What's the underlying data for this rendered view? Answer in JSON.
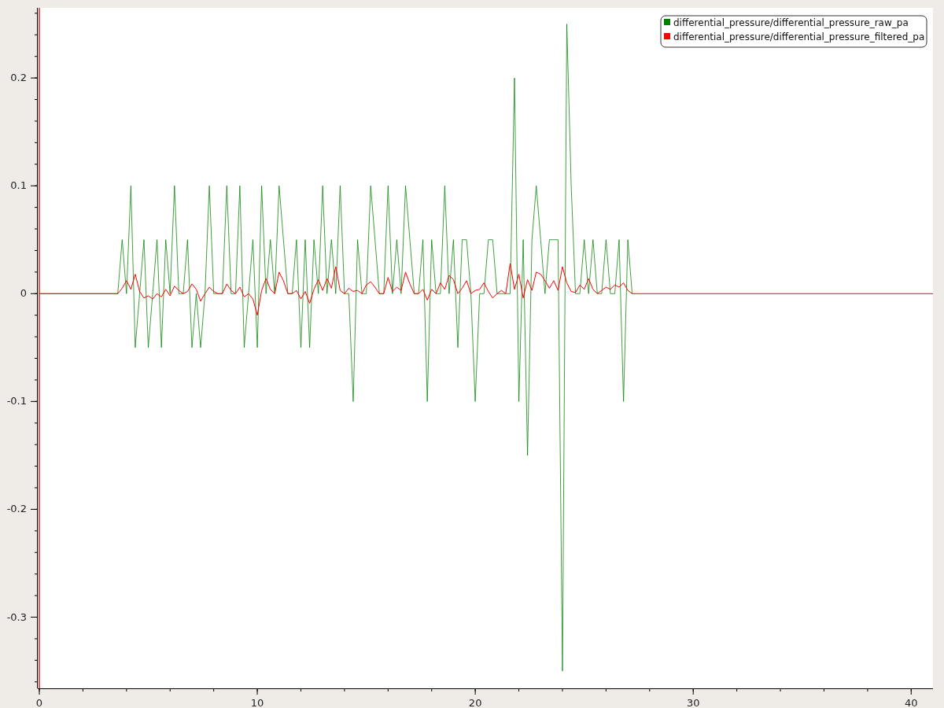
{
  "chart_data": {
    "type": "line",
    "xlim": [
      0,
      41
    ],
    "ylim": [
      -0.366,
      0.265
    ],
    "legend": "top-right",
    "xticks": [
      0,
      10,
      20,
      30,
      40
    ],
    "yticks": [
      {
        "value": -0.3,
        "label": "-0.3"
      },
      {
        "value": -0.2,
        "label": "-0.2"
      },
      {
        "value": -0.1,
        "label": "-0.1"
      },
      {
        "value": 0,
        "label": "0"
      },
      {
        "value": 0.1,
        "label": "0.1"
      },
      {
        "value": 0.2,
        "label": "0.2"
      }
    ],
    "x": [
      0,
      3.6,
      3.8,
      4.0,
      4.2,
      4.4,
      4.6,
      4.8,
      5.0,
      5.2,
      5.4,
      5.6,
      5.8,
      6.0,
      6.2,
      6.4,
      6.6,
      6.8,
      7.0,
      7.2,
      7.4,
      7.6,
      7.8,
      8.0,
      8.2,
      8.4,
      8.6,
      8.8,
      9.0,
      9.2,
      9.4,
      9.6,
      9.8,
      10.0,
      10.2,
      10.4,
      10.6,
      10.8,
      11.0,
      11.2,
      11.4,
      11.6,
      11.8,
      12.0,
      12.2,
      12.4,
      12.6,
      12.8,
      13.0,
      13.2,
      13.4,
      13.6,
      13.8,
      14.0,
      14.2,
      14.4,
      14.6,
      14.8,
      15.0,
      15.2,
      15.4,
      15.6,
      15.8,
      16.0,
      16.2,
      16.4,
      16.6,
      16.8,
      17.0,
      17.2,
      17.4,
      17.6,
      17.8,
      18.0,
      18.2,
      18.4,
      18.6,
      18.8,
      19.0,
      19.2,
      19.4,
      19.6,
      19.8,
      20.0,
      20.2,
      20.4,
      20.6,
      20.8,
      21.0,
      21.2,
      21.4,
      21.6,
      21.8,
      22.0,
      22.2,
      22.4,
      22.6,
      22.8,
      23.0,
      23.2,
      23.4,
      23.6,
      23.8,
      24.0,
      24.2,
      24.4,
      24.6,
      24.8,
      25.0,
      25.2,
      25.4,
      25.6,
      25.8,
      26.0,
      26.2,
      26.4,
      26.6,
      26.8,
      27.0,
      27.2,
      27.4,
      41
    ],
    "series": [
      {
        "name": "differential_pressure/differential_pressure_raw_pa",
        "color": "#008000",
        "values": [
          0,
          0,
          0.05,
          0,
          0.1,
          -0.05,
          0,
          0.05,
          -0.05,
          0,
          0.05,
          -0.05,
          0.05,
          0,
          0.1,
          0,
          0,
          0.05,
          -0.05,
          0,
          -0.05,
          0,
          0.1,
          0,
          0,
          0,
          0.1,
          0,
          0,
          0.1,
          -0.05,
          0,
          0.05,
          -0.05,
          0.1,
          0,
          0.05,
          0,
          0.1,
          0.05,
          0,
          0,
          0.05,
          -0.05,
          0.05,
          -0.05,
          0.05,
          0,
          0.1,
          0,
          0.05,
          0,
          0.1,
          0,
          0,
          -0.1,
          0.05,
          0,
          0,
          0.1,
          0.05,
          0,
          0,
          0.1,
          0,
          0.05,
          0,
          0.1,
          0.05,
          0,
          0,
          0.05,
          -0.1,
          0.05,
          0,
          0,
          0.1,
          0,
          0.05,
          -0.05,
          0.05,
          0.05,
          0,
          -0.1,
          0,
          0,
          0.05,
          0.05,
          0,
          0,
          0,
          0,
          0.2,
          -0.1,
          0.05,
          -0.15,
          0.05,
          0.1,
          0.05,
          0,
          0.05,
          0.05,
          0.05,
          -0.35,
          0.25,
          0.1,
          0,
          0,
          0.05,
          0,
          0.05,
          0,
          0,
          0.05,
          0,
          0,
          0.05,
          -0.1,
          0.05,
          0,
          null,
          null
        ]
      },
      {
        "name": "differential_pressure/differential_pressure_filtered_pa",
        "color": "#ff0000",
        "values": [
          0,
          0,
          0.005,
          0.012,
          0.004,
          0.018,
          0.002,
          -0.004,
          -0.002,
          -0.005,
          0,
          -0.003,
          0.004,
          -0.002,
          0.007,
          0.003,
          0,
          0.002,
          0.009,
          0.004,
          -0.007,
          0,
          0.006,
          0.002,
          0,
          0,
          0.009,
          0.003,
          0,
          0.006,
          -0.003,
          0,
          -0.005,
          -0.02,
          0.003,
          0.014,
          0.004,
          0,
          0.02,
          0.012,
          0,
          0,
          0.003,
          -0.005,
          0.002,
          -0.009,
          0.004,
          0.013,
          0.003,
          0.014,
          0.005,
          0.025,
          0.003,
          0,
          0.005,
          0.002,
          0.003,
          0,
          0.008,
          0.011,
          0.006,
          0,
          0,
          0.015,
          0.002,
          0.006,
          0.003,
          0.02,
          0.009,
          0,
          0,
          0.004,
          -0.006,
          0.004,
          0,
          0.01,
          0.004,
          0.017,
          0.013,
          0,
          0.005,
          0.012,
          0,
          0.003,
          0.004,
          0.01,
          0.002,
          -0.004,
          0,
          0.003,
          0,
          0.028,
          0.004,
          0.018,
          -0.004,
          0.013,
          0.003,
          0.02,
          0.018,
          0.012,
          0.005,
          0.012,
          0.003,
          0.025,
          0.01,
          0.002,
          0.001,
          0.008,
          0.004,
          0.014,
          0.004,
          0,
          0.003,
          0.006,
          0.004,
          0.008,
          0.006,
          0.01,
          0.003,
          0,
          0,
          0
        ]
      }
    ]
  }
}
